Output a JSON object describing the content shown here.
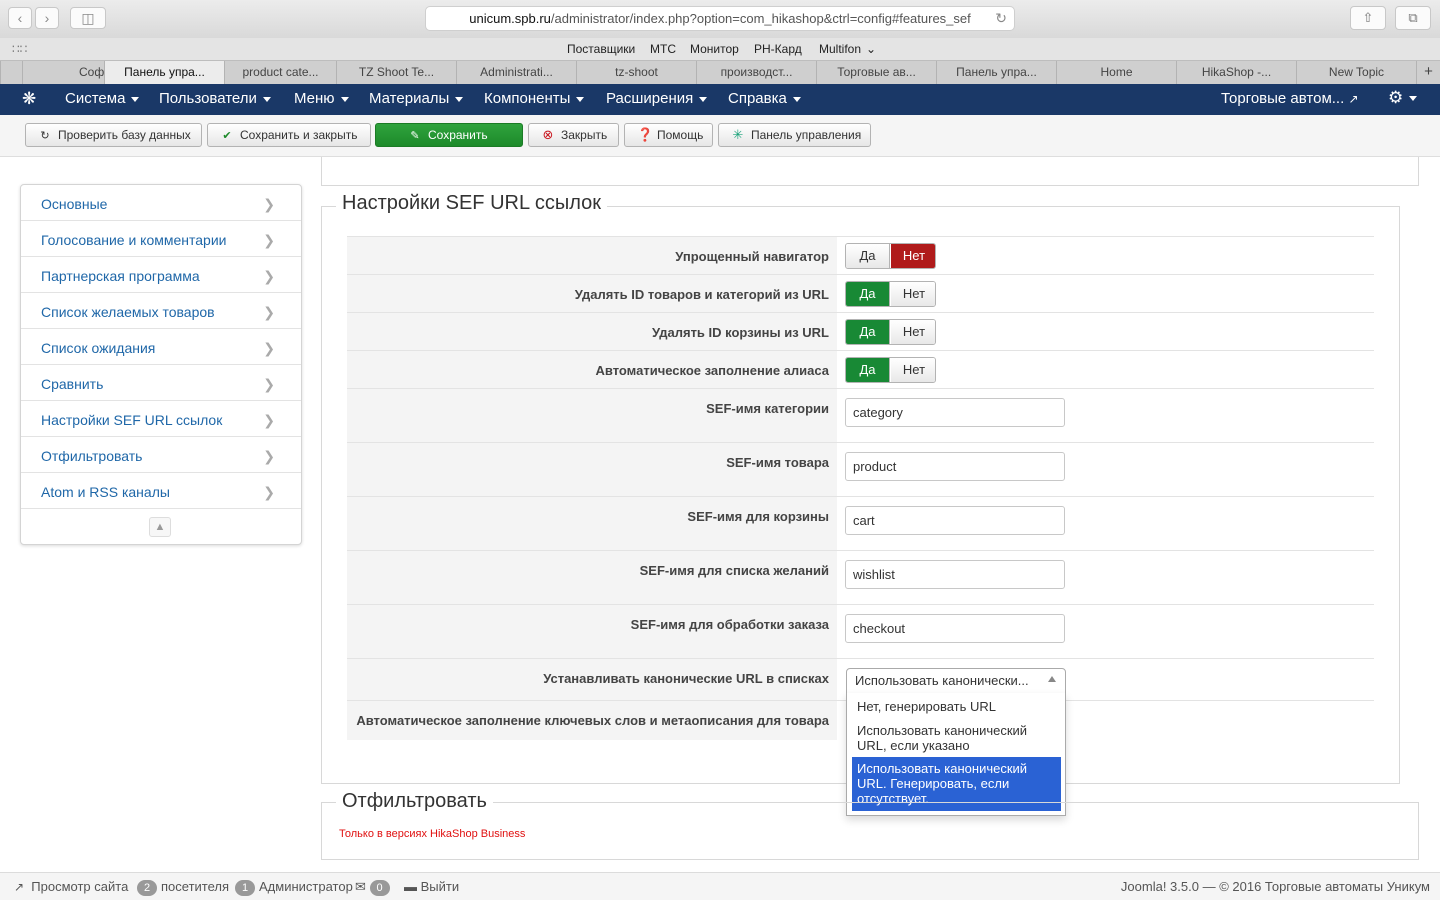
{
  "browser": {
    "address_host": "unicum.spb.ru",
    "address_path": "/administrator/index.php?option=com_hikashop&ctrl=config#features_sef",
    "bookmarks": [
      "Поставщики",
      "МТС",
      "Монитор",
      "РН-Кард",
      "Multifon"
    ],
    "tabs": [
      "Соф",
      "Панель упра...",
      "product cate...",
      "TZ Shoot Te...",
      "Administrati...",
      "tz-shoot",
      "производст...",
      "Торговые ав...",
      "Панель упра...",
      "Home",
      "HikaShop -...",
      "New Topic"
    ],
    "active_tab_index": 1
  },
  "nav": {
    "menus": [
      "Система",
      "Пользователи",
      "Меню",
      "Материалы",
      "Компоненты",
      "Расширения",
      "Справка"
    ],
    "site_link": "Торговые автом..."
  },
  "toolbar": {
    "check_db": "Проверить базу данных",
    "save_close": "Сохранить и закрыть",
    "save": "Сохранить",
    "close": "Закрыть",
    "help": "Помощь",
    "control_panel": "Панель управления"
  },
  "sidebar": {
    "items": [
      "Основные",
      "Голосование и комментарии",
      "Партнерская программа",
      "Список желаемых товаров",
      "Список ожидания",
      "Сравнить",
      "Настройки SEF URL ссылок",
      "Отфильтровать",
      "Atom и RSS каналы"
    ]
  },
  "sef": {
    "legend": "Настройки SEF URL ссылок",
    "yes_label": "Да",
    "no_label": "Нет",
    "toggles": [
      {
        "label": "Упрощенный навигатор",
        "value": "Нет"
      },
      {
        "label": "Удалять ID товаров и категорий из URL",
        "value": "Да"
      },
      {
        "label": "Удалять ID корзины из URL",
        "value": "Да"
      },
      {
        "label": "Автоматическое заполнение алиаса",
        "value": "Да"
      }
    ],
    "inputs": [
      {
        "label": "SEF-имя категории",
        "value": "category"
      },
      {
        "label": "SEF-имя товара",
        "value": "product"
      },
      {
        "label": "SEF-имя для корзины",
        "value": "cart"
      },
      {
        "label": "SEF-имя для списка желаний",
        "value": "wishlist"
      },
      {
        "label": "SEF-имя для обработки заказа",
        "value": "checkout"
      }
    ],
    "canonical_label": "Устанавливать канонические URL в списках",
    "canonical_selected": "Использовать канонически...",
    "canonical_options": [
      "Нет, генерировать URL",
      "Использовать канонический URL, если указано",
      "Использовать канонический URL. Генерировать, если отсутствует."
    ],
    "canonical_selected_index": 2,
    "meta_label": "Автоматическое заполнение ключевых слов и метаописания для товара"
  },
  "filter": {
    "legend": "Отфильтровать",
    "note": "Только в версиях HikaShop Business"
  },
  "status": {
    "view_site": "Просмотр сайта",
    "visitors_count": "2",
    "visitors_label": "посетителя",
    "admins_count": "1",
    "admins_label": "Администратор",
    "messages_count": "0",
    "logout": "Выйти",
    "footer": "Joomla! 3.5.0  —  © 2016 Торговые автоматы Уникум"
  },
  "colors": {
    "nav_bg": "#1a3867",
    "save_green": "#1d8a2a",
    "yes_active": "#188935",
    "no_active": "#b01b1b",
    "link": "#1f67a8",
    "option_selected": "#2a62d4"
  }
}
